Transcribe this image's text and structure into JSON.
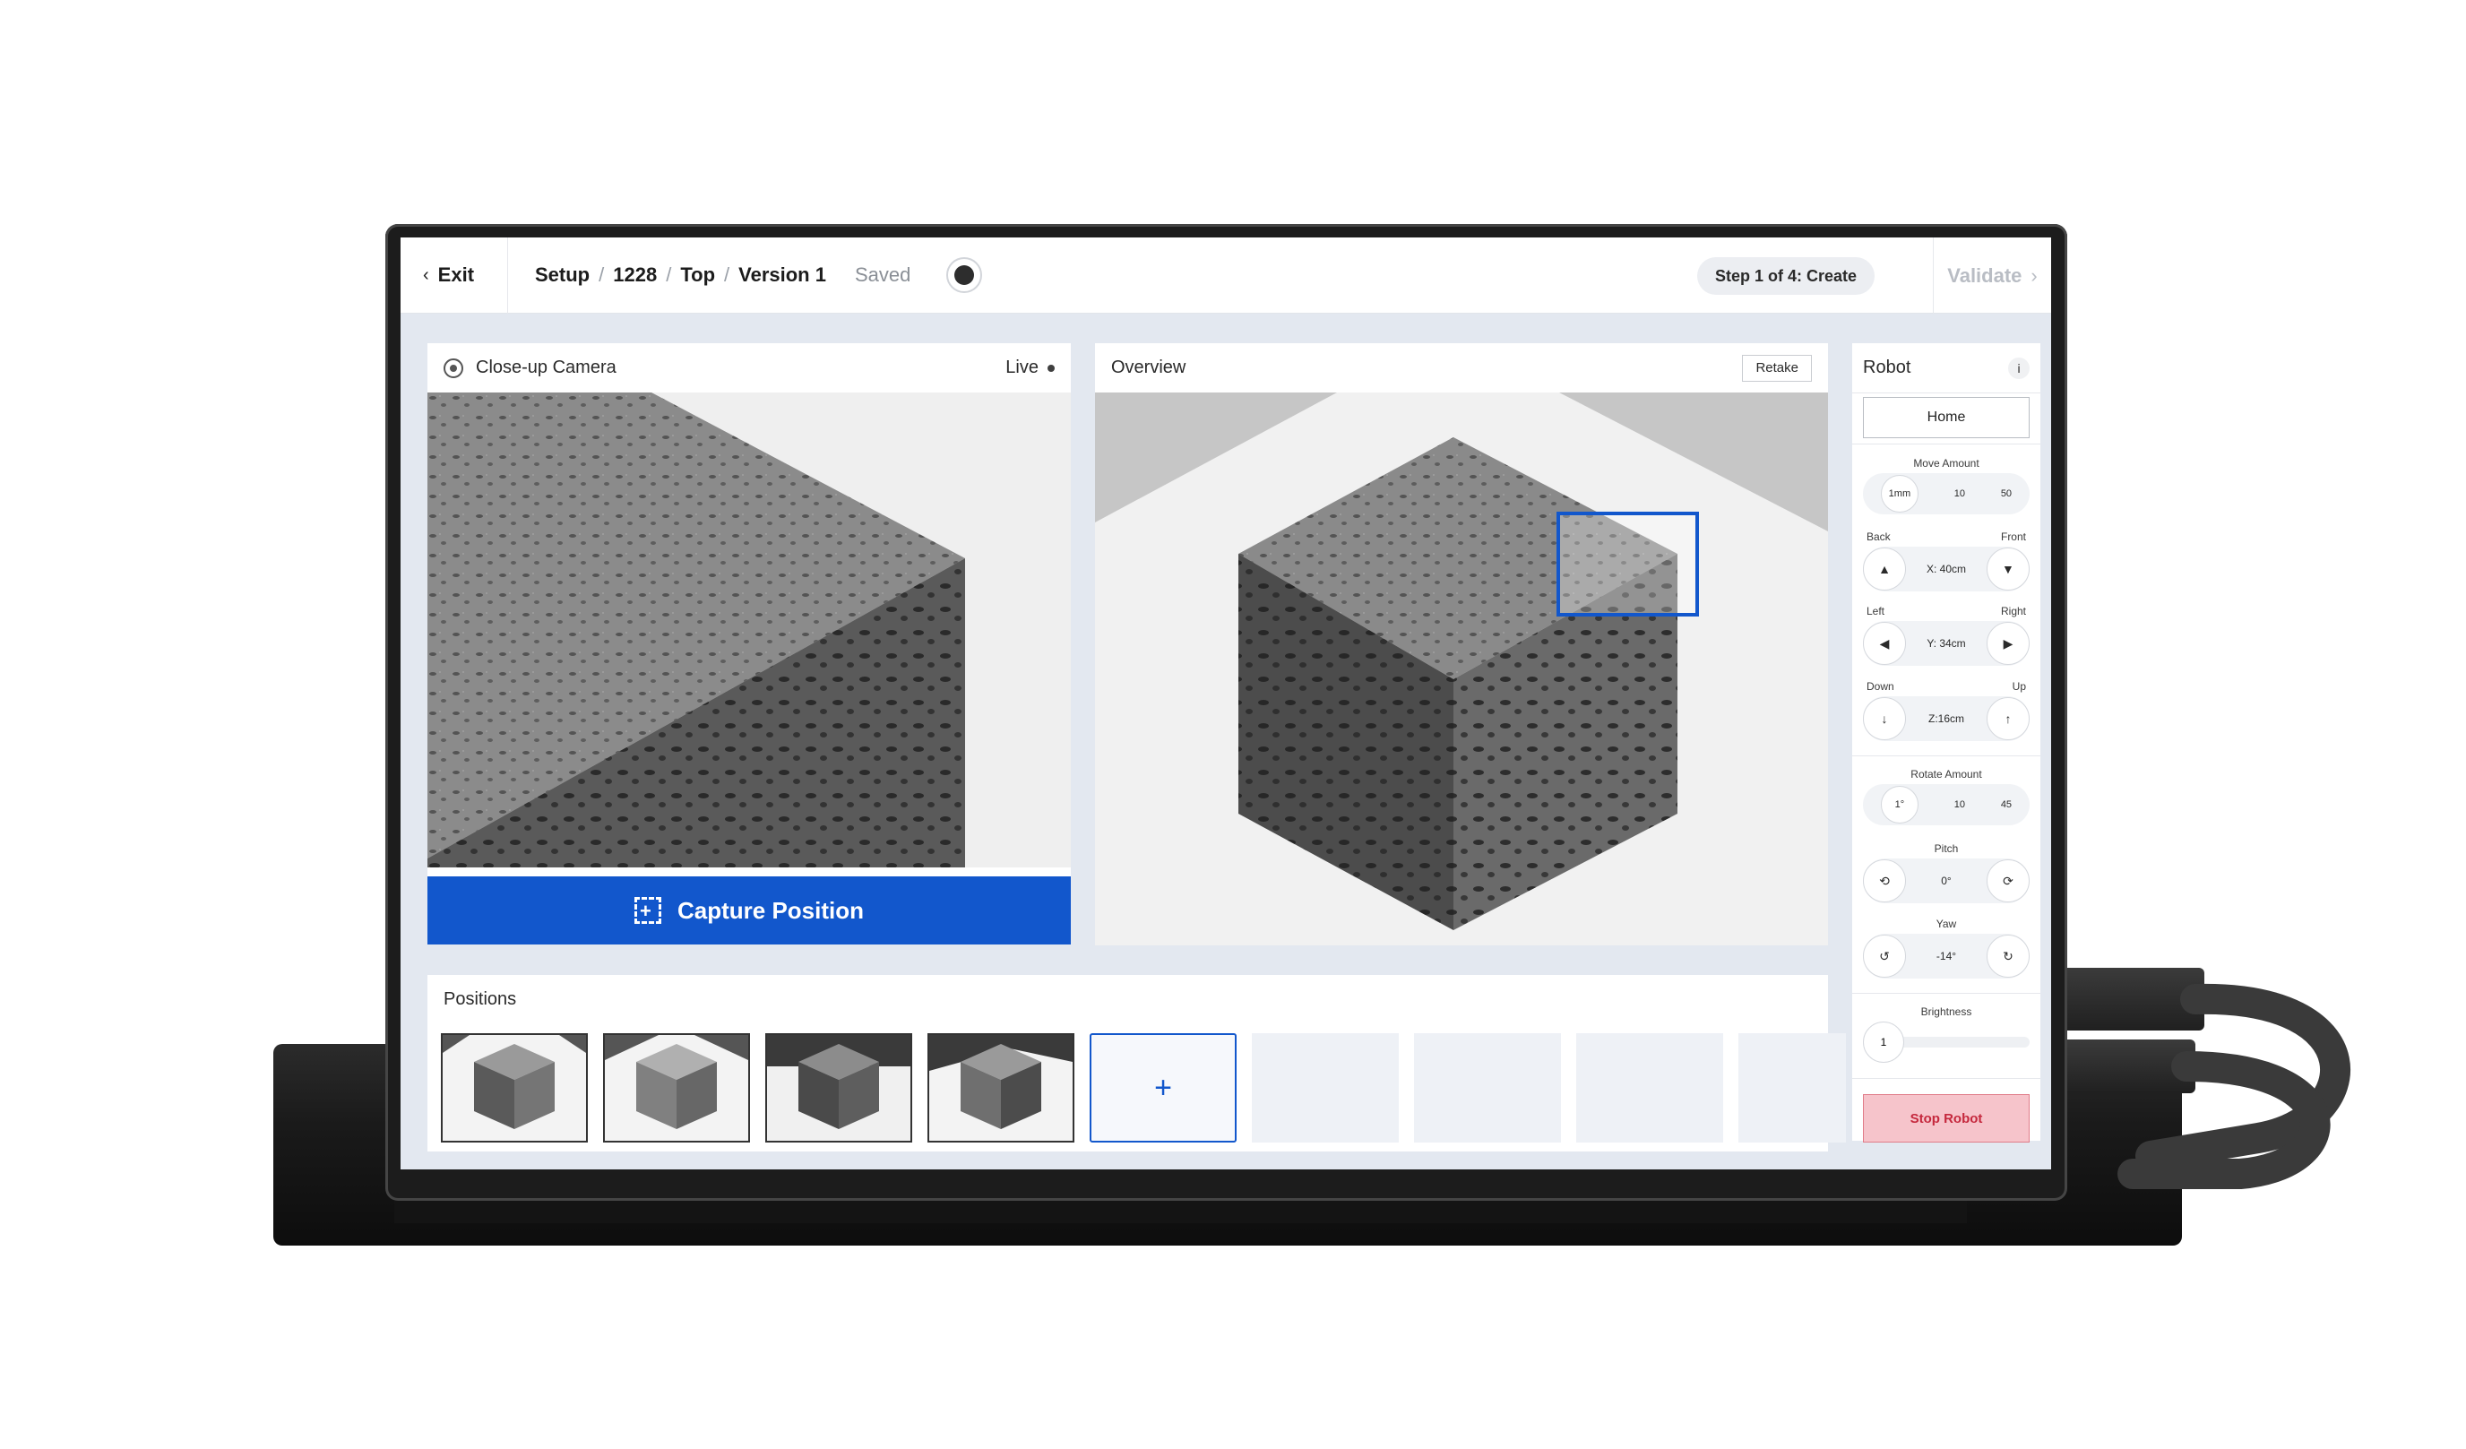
{
  "topbar": {
    "exit_label": "Exit",
    "crumbs": [
      "Setup",
      "1228",
      "Top",
      "Version 1"
    ],
    "status": "Saved",
    "step": "Step 1 of 4: Create",
    "validate_label": "Validate"
  },
  "camera": {
    "title": "Close-up Camera",
    "live_label": "Live",
    "capture_label": "Capture Position"
  },
  "overview": {
    "title": "Overview",
    "retake_label": "Retake"
  },
  "positions": {
    "title": "Positions",
    "add_label": "+"
  },
  "robot": {
    "title": "Robot",
    "info_label": "i",
    "home_label": "Home",
    "move_amount_label": "Move Amount",
    "move_amounts": [
      "1mm",
      "10",
      "50"
    ],
    "x": {
      "left_label": "Back",
      "right_label": "Front",
      "value": "X: 40cm"
    },
    "y": {
      "left_label": "Left",
      "right_label": "Right",
      "value": "Y: 34cm"
    },
    "z": {
      "left_label": "Down",
      "right_label": "Up",
      "value": "Z:16cm"
    },
    "rotate_amount_label": "Rotate Amount",
    "rotate_amounts": [
      "1°",
      "10",
      "45"
    ],
    "pitch": {
      "label": "Pitch",
      "value": "0°"
    },
    "yaw": {
      "label": "Yaw",
      "value": "-14°"
    },
    "brightness": {
      "label": "Brightness",
      "value": "1"
    },
    "stop_label": "Stop Robot"
  },
  "colors": {
    "accent": "#1257cc",
    "stop_bg": "#f6c4cb",
    "stop_text": "#c5283d",
    "screen_bg": "#e3e8f0"
  }
}
